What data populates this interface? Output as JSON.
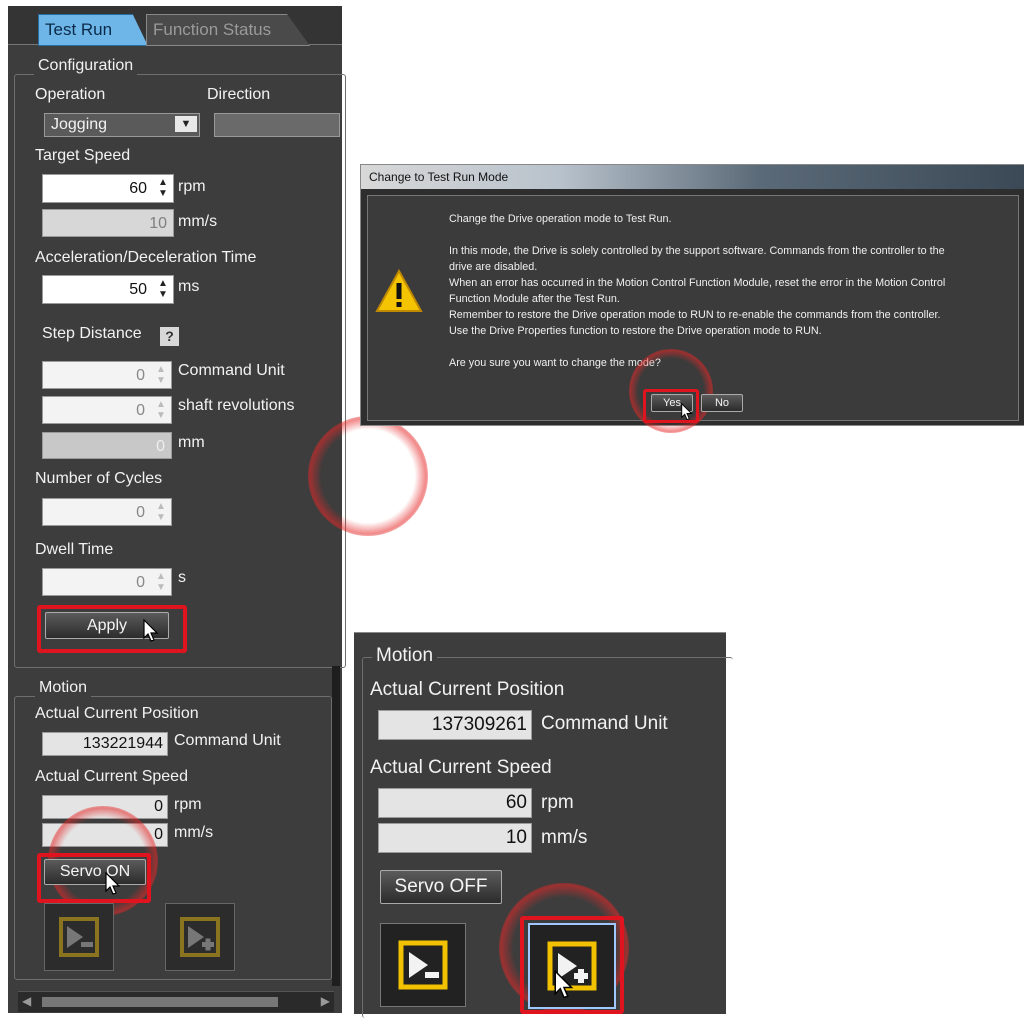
{
  "left": {
    "tabs": [
      "Test Run",
      "Function Status"
    ],
    "configuration": {
      "title": "Configuration",
      "operation_label": "Operation",
      "direction_label": "Direction",
      "operation_value": "Jogging",
      "target_speed_label": "Target Speed",
      "target_speed_value": "60",
      "target_speed_unit": "rpm",
      "target_speed_mm_value": "10",
      "target_speed_mm_unit": "mm/s",
      "accel_label": "Acceleration/Deceleration Time",
      "accel_value": "50",
      "accel_unit": "ms",
      "step_label": "Step Distance",
      "help_icon_text": "?",
      "step_value": "0",
      "step_unit": "Command Unit",
      "shaft_value": "0",
      "shaft_unit": "shaft revolutions",
      "mm_value": "0",
      "mm_unit": "mm",
      "cycles_label": "Number of Cycles",
      "cycles_value": "0",
      "dwell_label": "Dwell Time",
      "dwell_value": "0",
      "dwell_unit": "s",
      "apply_label": "Apply"
    },
    "motion": {
      "title": "Motion",
      "position_label": "Actual Current Position",
      "position_value": "133221944",
      "position_unit": "Command Unit",
      "speed_label": "Actual Current Speed",
      "speed_rpm_value": "0",
      "speed_rpm_unit": "rpm",
      "speed_mm_value": "0",
      "speed_mm_unit": "mm/s",
      "servo_label": "Servo ON"
    }
  },
  "dialog": {
    "title": "Change to Test Run Mode",
    "lines": [
      "Change the Drive operation mode to Test Run.",
      "",
      "In this mode, the Drive is solely controlled by the support software. Commands from the controller to the",
      "drive are disabled.",
      "When an error has occurred in the Motion Control Function Module, reset the error in the Motion Control",
      "Function Module after the Test Run.",
      "Remember to restore the Drive operation mode to RUN to re-enable the commands from the controller.",
      "Use the Drive Properties function to restore the Drive operation mode to RUN.",
      "",
      "Are you sure you want to change the mode?"
    ],
    "yes_label": "Yes",
    "no_label": "No"
  },
  "motion2": {
    "title": "Motion",
    "position_label": "Actual Current Position",
    "position_value": "137309261",
    "position_unit": "Command Unit",
    "speed_label": "Actual Current Speed",
    "speed_rpm_value": "60",
    "speed_rpm_unit": "rpm",
    "speed_mm_value": "10",
    "speed_mm_unit": "mm/s",
    "servo_label": "Servo OFF"
  },
  "colors": {
    "panel": "#3d3d3d",
    "highlight": "#e0141e",
    "tab_active": "#6fb6e8",
    "jog_icon": "#f2c200"
  },
  "icons": [
    "jog-reverse-icon",
    "jog-forward-icon",
    "warning-icon",
    "help-icon",
    "cursor-icon",
    "spin-arrows-icon",
    "dropdown-arrow-icon"
  ]
}
